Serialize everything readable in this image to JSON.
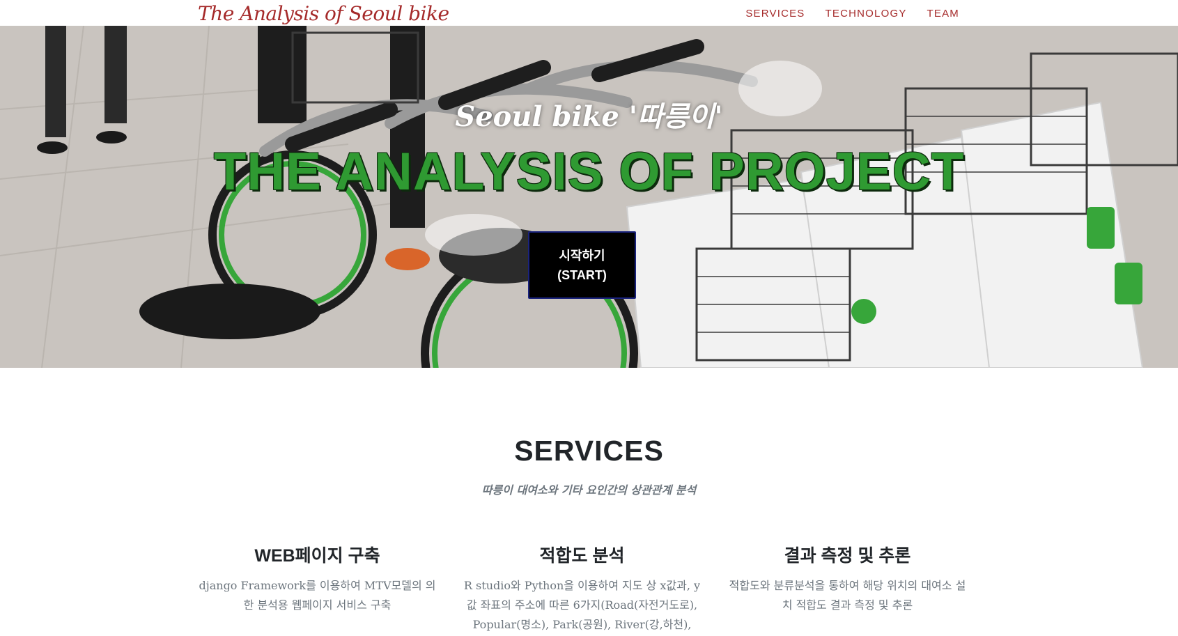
{
  "navbar": {
    "brand": "The Analysis of Seoul bike",
    "links": [
      "SERVICES",
      "TECHNOLOGY",
      "TEAM"
    ]
  },
  "hero": {
    "subtitle": "Seoul bike '따릉이'",
    "title": "THE ANALYSIS OF PROJECT",
    "start_label_line1": "시작하기",
    "start_label_line2": "(START)"
  },
  "services": {
    "heading": "SERVICES",
    "subheading": "따릉이 대여소와 기타 요인간의 상관관계 분석",
    "items": [
      {
        "title": "WEB페이지 구축",
        "text": "django Framework를 이용하여 MTV모델의 의한 분석용 웹페이지 서비스 구축"
      },
      {
        "title": "적합도 분석",
        "text": "R studio와 Python을 이용하여 지도 상 x값과, y값 좌표의 주소에 따른 6가지(Road(자전거도로), Popular(명소), Park(공원), River(강,하천),"
      },
      {
        "title": "결과 측정 및 추론",
        "text": "적합도와 분류분석을 통하여 해당 위치의 대여소 설치 적합도 결과 측정 및 추론"
      }
    ]
  },
  "colors": {
    "brand": "#a52a2a",
    "hero_title": "#2f9a32",
    "button_bg": "#000000",
    "muted_text": "#6c757d"
  }
}
